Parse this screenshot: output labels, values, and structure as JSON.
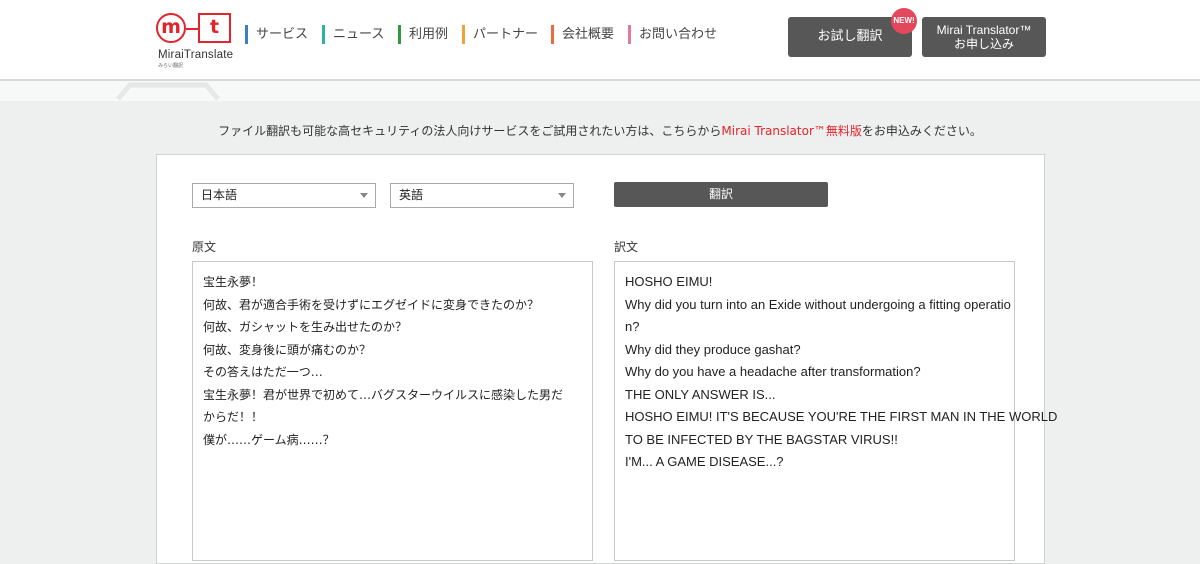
{
  "logo": {
    "left_letter": "m",
    "right_letter": "t",
    "brand": "MiraiTranslate",
    "brand_sub": "みらい翻訳"
  },
  "nav": [
    {
      "label": "サービス",
      "color": "#3a7ec6"
    },
    {
      "label": "ニュース",
      "color": "#2bb3a3"
    },
    {
      "label": "利用例",
      "color": "#2e9a3d"
    },
    {
      "label": "パートナー",
      "color": "#f0a23a"
    },
    {
      "label": "会社概要",
      "color": "#ec6a3b"
    },
    {
      "label": "お問い合わせ",
      "color": "#e3799b"
    }
  ],
  "header_buttons": {
    "trial_label": "お試し翻訳",
    "new_badge": "NEW!",
    "apply_line1": "Mirai Translator™",
    "apply_line2": "お申し込み"
  },
  "notice": {
    "before": "ファイル翻訳も可能な高セキュリティの法人向けサービスをご試用されたい方は、こちらから",
    "link": "Mirai Translator™無料版",
    "after": "をお申込みください。"
  },
  "translator": {
    "source_language": "日本語",
    "target_language": "英語",
    "translate_button": "翻訳",
    "source_label": "原文",
    "target_label": "訳文",
    "source_lines": [
      "宝生永夢！",
      "何故、君が適合手術を受けずにエグゼイドに変身できたのか？",
      "何故、ガシャットを生み出せたのか？",
      "何故、変身後に頭が痛むのか？",
      "その答えはただ一つ…",
      "宝生永夢！君が世界で初めて…バグスターウイルスに感染した男だ",
      "からだ！！",
      "僕が……ゲーム病……？"
    ],
    "target_lines": [
      "HOSHO EIMU!",
      "Why did you turn into an Exide without undergoing a fitting operatio",
      "n?",
      "Why did they produce gashat?",
      "Why do you have a headache after transformation?",
      "THE ONLY ANSWER IS...",
      "HOSHO EIMU! IT'S BECAUSE YOU'RE THE FIRST MAN IN THE WORLD",
      "TO BE INFECTED BY THE BAGSTAR VIRUS!!",
      "I'M... A GAME DISEASE...?"
    ]
  },
  "colors": {
    "accent_red": "#e3242b",
    "button_dark": "#575757",
    "page_bg": "#edf0ef"
  }
}
